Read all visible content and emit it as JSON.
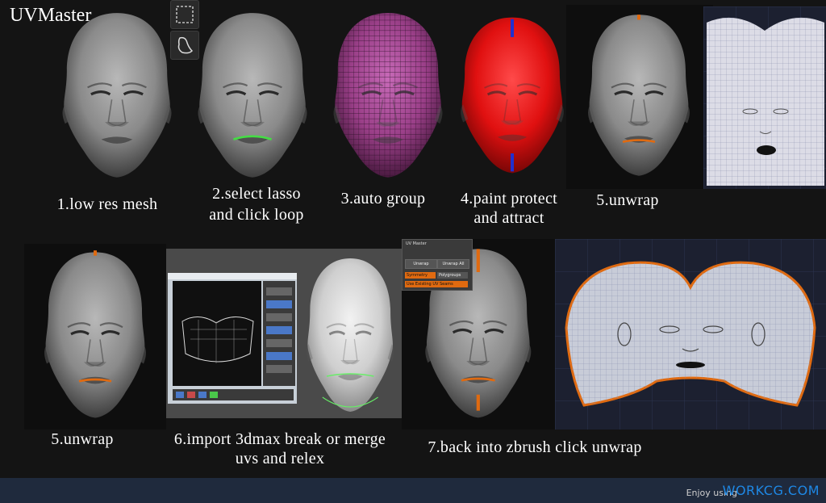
{
  "header": {
    "title": "UVMaster"
  },
  "captions": {
    "step1": "1.low res mesh",
    "step2_line1": "2.select lasso",
    "step2_line2": "and click loop",
    "step3": "3.auto group",
    "step4_line1": "4.paint protect",
    "step4_line2": "and attract",
    "step5a": "5.unwrap",
    "step5b": "5.unwrap",
    "step6_line1": "6.import 3dmax break or merge",
    "step6_line2": "uvs and relex",
    "step7": "7.back into zbrush click unwrap"
  },
  "uv_master_panel": {
    "title": "UV Master",
    "unwrap_label": "Unwrap",
    "unwrap_all_label": "Unwrap All",
    "symmetry_label": "Symmetry",
    "polygroups_label": "Polygroups",
    "use_existing_label": "Use Existing UV Seams"
  },
  "footer": {
    "enjoy_text": "Enjoy using",
    "brand": "WORKCG.COM"
  },
  "colors": {
    "background": "#141414",
    "head_gray": "#8c8c8c",
    "head_magenta": "#a0448f",
    "head_red": "#e81414",
    "seam_orange": "#e06a10",
    "seam_green": "#44dd44",
    "uv_bg": "#1c2030",
    "uv_grid": "#8a90b0",
    "footer_bg": "#1f2a3d",
    "brand_blue": "#1e88e5"
  },
  "icons": [
    "rect-select-icon",
    "lasso-select-icon"
  ]
}
